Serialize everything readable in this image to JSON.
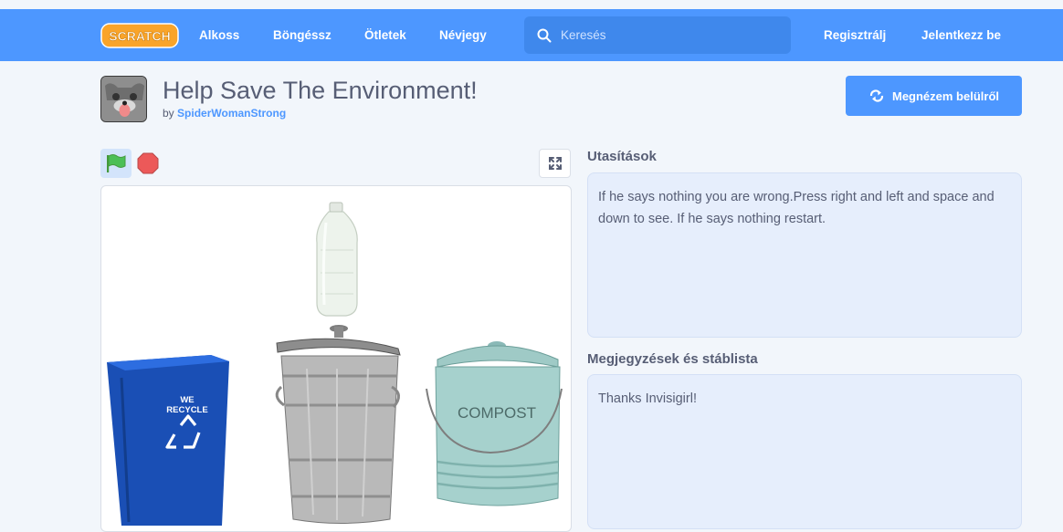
{
  "nav": {
    "logo_text": "SCRATCH",
    "links": [
      "Alkoss",
      "Böngéssz",
      "Ötletek",
      "Névjegy"
    ],
    "search_placeholder": "Keresés",
    "register": "Regisztrálj",
    "login": "Jelentkezz be",
    "colors": {
      "bar": "#4d97ff",
      "logo": "#f9a42a"
    }
  },
  "project": {
    "title": "Help Save The Environment!",
    "by_prefix": "by",
    "author": "SpiderWomanStrong",
    "see_inside_label": "Megnézem belülről"
  },
  "player": {
    "green_flag_icon": "green-flag-icon",
    "stop_icon": "stop-icon",
    "fullscreen_icon": "fullscreen-icon",
    "stage_text": {
      "recycle_line1": "WE",
      "recycle_line2": "RECYCLE",
      "compost": "COMPOST"
    }
  },
  "instructions": {
    "label": "Utasítások",
    "text": "If he says nothing you are wrong.Press right and left and space and down to see. If he says nothing restart."
  },
  "notes": {
    "label": "Megjegyzések és stáblista",
    "text": "Thanks Invisigirl!"
  }
}
